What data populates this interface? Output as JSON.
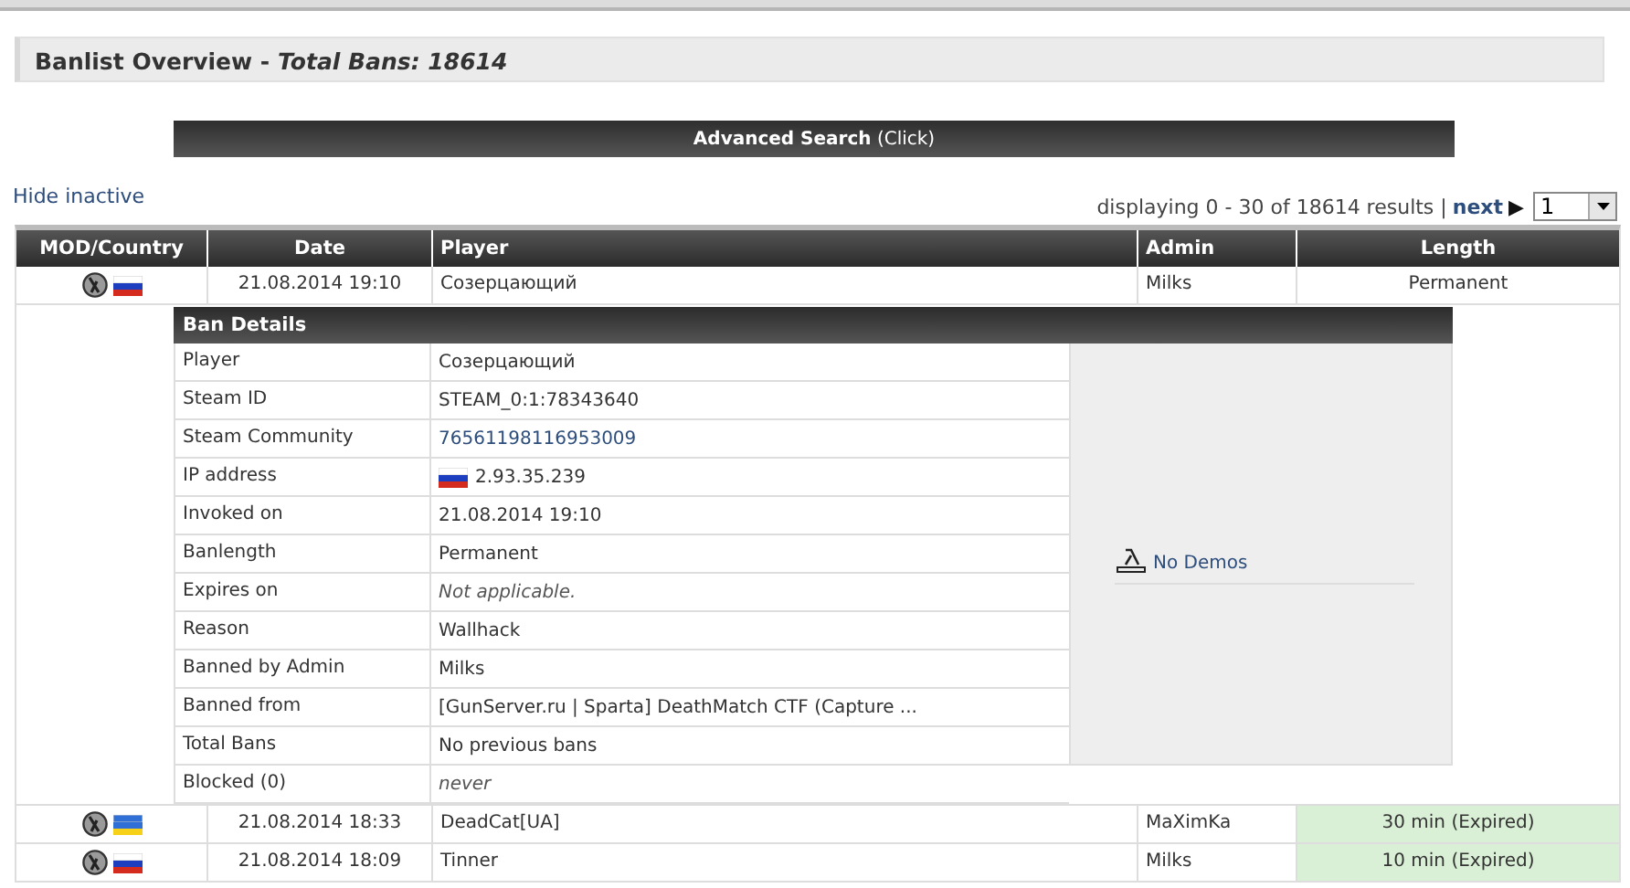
{
  "title": "Banlist Overview - *Total Bans: 18614*",
  "advanced_search": "**Advanced Search** (Click)",
  "hide_inactive": "Hide inactive",
  "pagination": {
    "summary": "displaying 0 - 30 of 18614 results |",
    "next": "next",
    "arrow": "▶",
    "page": "1"
  },
  "table": {
    "columns": [
      "MOD/Country",
      "Date",
      "Player",
      "Admin",
      "Length"
    ],
    "rows": [
      {
        "flag": {
          "kind": "ru"
        },
        "date": "21.08.2014 19:10",
        "player": "Созерцающий",
        "admin": "Milks",
        "length": "Permanent",
        "expired": false,
        "expanded": true
      },
      {
        "flag": {
          "kind": "ua"
        },
        "date": "21.08.2014 18:33",
        "player": "DeadCat[UA]",
        "admin": "MaXimKa",
        "length": "30 min (Expired)",
        "expired": true,
        "expanded": false
      },
      {
        "flag": {
          "kind": "ru"
        },
        "date": "21.08.2014 18:09",
        "player": "Tinner",
        "admin": "Milks",
        "length": "10 min (Expired)",
        "expired": true,
        "expanded": false
      }
    ]
  },
  "ban_details": {
    "title": "Ban Details",
    "fields": [
      {
        "label": "Player",
        "value": "Созерцающий",
        "kind": "text"
      },
      {
        "label": "Steam ID",
        "value": "STEAM_0:1:78343640",
        "kind": "text"
      },
      {
        "label": "Steam Community",
        "value": "76561198116953009",
        "kind": "link"
      },
      {
        "label": "IP address",
        "value": "2.93.35.239",
        "kind": "ip",
        "flag": {
          "kind": "ru"
        }
      },
      {
        "label": "Invoked on",
        "value": "21.08.2014 19:10",
        "kind": "text"
      },
      {
        "label": "Banlength",
        "value": "Permanent",
        "kind": "text"
      },
      {
        "label": "Expires on",
        "value": "Not applicable.",
        "kind": "muted"
      },
      {
        "label": "Reason",
        "value": "Wallhack",
        "kind": "text"
      },
      {
        "label": "Banned by Admin",
        "value": "Milks",
        "kind": "text"
      },
      {
        "label": "Banned from",
        "value": "[GunServer.ru | Sparta] DeathMatch CTF (Capture ...",
        "kind": "text"
      },
      {
        "label": "Total Bans",
        "value": "No previous bans",
        "kind": "text"
      },
      {
        "label": "Blocked (0)",
        "value": "never",
        "kind": "muted"
      }
    ],
    "demos": "No Demos"
  }
}
